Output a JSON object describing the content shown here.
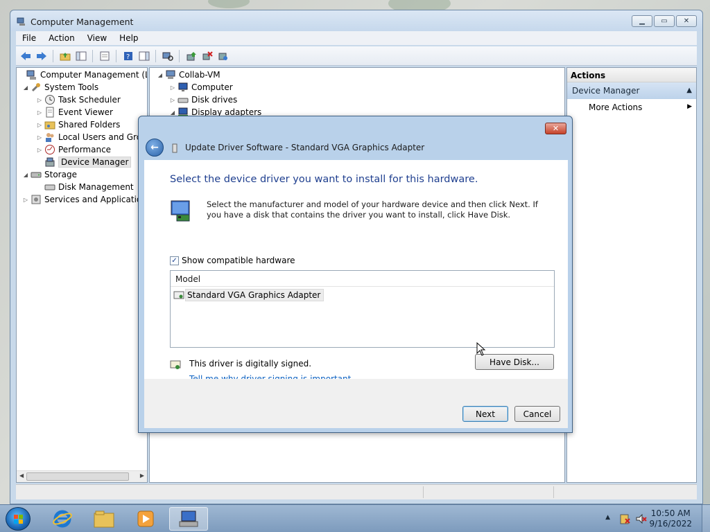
{
  "window": {
    "title": "Computer Management",
    "menu": [
      "File",
      "Action",
      "View",
      "Help"
    ]
  },
  "tree": {
    "root": "Computer Management (Local",
    "system_tools": "System Tools",
    "task_scheduler": "Task Scheduler",
    "event_viewer": "Event Viewer",
    "shared_folders": "Shared Folders",
    "local_users": "Local Users and Group",
    "performance": "Performance",
    "device_manager": "Device Manager",
    "storage": "Storage",
    "disk_management": "Disk Management",
    "services": "Services and Applications"
  },
  "devices": {
    "root": "Collab-VM",
    "computer": "Computer",
    "disk_drives": "Disk drives",
    "display_adapters": "Display adapters"
  },
  "actions": {
    "header": "Actions",
    "section": "Device Manager",
    "more": "More Actions"
  },
  "dialog": {
    "title": "Update Driver Software - Standard VGA Graphics Adapter",
    "heading": "Select the device driver you want to install for this hardware.",
    "description": "Select the manufacturer and model of your hardware device and then click Next. If you have a disk that contains the driver you want to install, click Have Disk.",
    "show_compatible": "Show compatible hardware",
    "show_compatible_checked": true,
    "model_header": "Model",
    "models": [
      "Standard VGA Graphics Adapter"
    ],
    "signed_text": "This driver is digitally signed.",
    "signed_link": "Tell me why driver signing is important",
    "have_disk": "Have Disk...",
    "next": "Next",
    "cancel": "Cancel"
  },
  "taskbar": {
    "time": "10:50 AM",
    "date": "9/16/2022"
  },
  "colors": {
    "heading_blue": "#1f3f8f",
    "link_blue": "#0b61c2",
    "close_red": "#c6422a"
  }
}
